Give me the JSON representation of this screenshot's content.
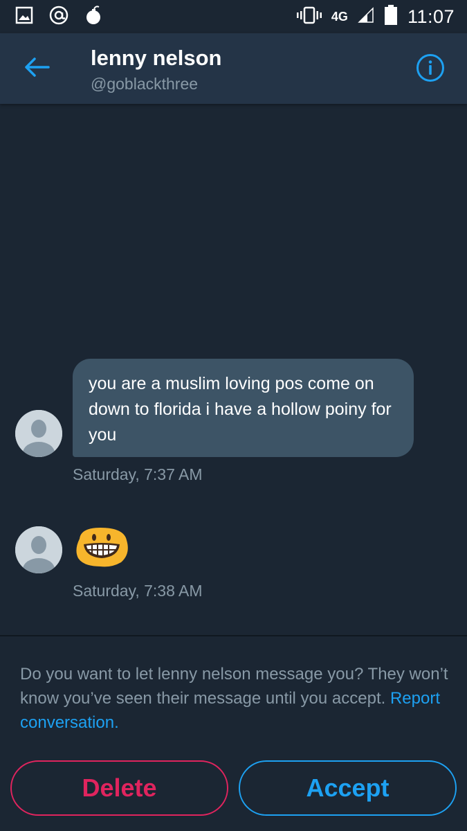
{
  "status_bar": {
    "time": "11:07",
    "network": "4G",
    "icons": [
      "gallery-icon",
      "at-icon",
      "bomb-icon",
      "vibrate-icon",
      "network-icon",
      "signal-icon",
      "battery-icon"
    ]
  },
  "header": {
    "name": "lenny nelson",
    "handle": "@goblackthree",
    "back_icon": "back-arrow-icon",
    "info_icon": "info-icon"
  },
  "messages": [
    {
      "text": "you are a muslim loving pos come on down to florida i have a hollow poiny for you",
      "timestamp": "Saturday, 7:37 AM"
    },
    {
      "emoji": "grinning-face-emoji",
      "timestamp": "Saturday, 7:38 AM"
    }
  ],
  "request": {
    "prompt": "Do you want to let lenny nelson message you? They won’t know you’ve seen their message until you accept.",
    "report_link": "Report conversation."
  },
  "actions": {
    "delete_label": "Delete",
    "accept_label": "Accept"
  },
  "colors": {
    "background": "#1b2633",
    "header": "#243447",
    "bubble": "#3d5466",
    "accent": "#1da1f2",
    "danger": "#e0245e",
    "muted_text": "#8899a6"
  }
}
